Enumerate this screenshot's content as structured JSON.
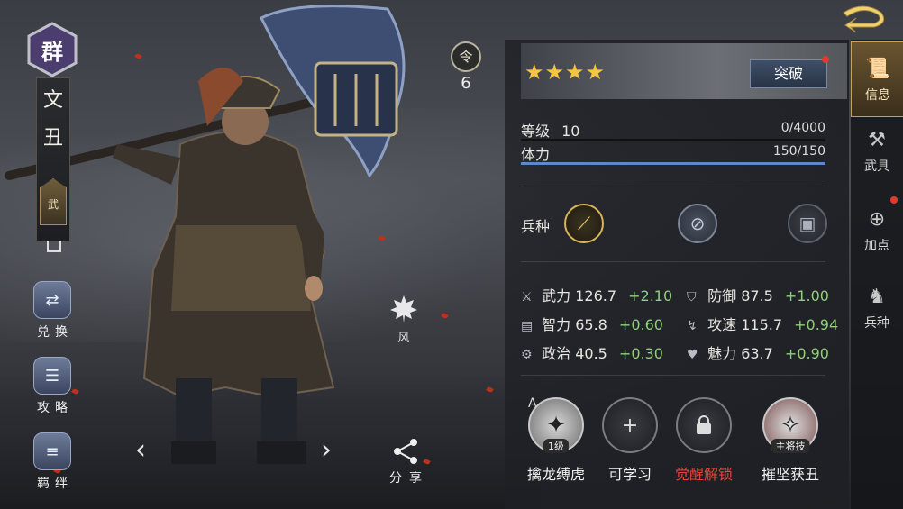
{
  "hero": {
    "faction": "群",
    "name_chars": [
      "文",
      "丑"
    ],
    "role": "武",
    "ling_label": "令",
    "ling_count": "6"
  },
  "side_buttons": [
    {
      "label": "兑换",
      "icon": "exchange-icon"
    },
    {
      "label": "攻略",
      "icon": "guide-scroll-icon"
    },
    {
      "label": "羁绊",
      "icon": "bond-scroll-icon"
    }
  ],
  "wind": {
    "label": "风",
    "icon": "maple-leaf-icon"
  },
  "share": {
    "label": "分享",
    "icon": "share-icon"
  },
  "panel": {
    "stars": "★★★★",
    "star_count": 4,
    "break_label": "突破",
    "level_label": "等级",
    "level_value": "10",
    "exp_value": "0/4000",
    "exp_fraction": 0,
    "stamina_label": "体力",
    "stamina_value": "150/150",
    "stamina_fraction": 1,
    "troop_label": "兵种",
    "troop_icons": [
      "spear-troop-icon",
      "shield-troop-icon",
      "armor-troop-icon"
    ],
    "attributes": [
      {
        "icon": "sword-icon",
        "name": "武力",
        "value": "126.7",
        "bonus": "+2.10"
      },
      {
        "icon": "shield-icon",
        "name": "防御",
        "value": "87.5",
        "bonus": "+1.00"
      },
      {
        "icon": "book-icon",
        "name": "智力",
        "value": "65.8",
        "bonus": "+0.60"
      },
      {
        "icon": "boot-icon",
        "name": "攻速",
        "value": "115.7",
        "bonus": "+0.94"
      },
      {
        "icon": "gear-icon",
        "name": "政治",
        "value": "40.5",
        "bonus": "+0.30"
      },
      {
        "icon": "heart-icon",
        "name": "魅力",
        "value": "63.7",
        "bonus": "+0.90"
      }
    ],
    "skill_marker": "A",
    "skills": [
      {
        "name": "擒龙缚虎",
        "tag": "1级",
        "icon": "warrior-skill-icon",
        "red": false
      },
      {
        "name": "可学习",
        "tag": "",
        "icon": "plus-icon",
        "red": false
      },
      {
        "name": "觉醒解锁",
        "tag": "",
        "icon": "lock-icon",
        "red": true
      },
      {
        "name": "摧坚获丑",
        "tag": "主将技",
        "icon": "general-skill-icon",
        "red": false
      }
    ]
  },
  "tabs": [
    {
      "label": "信息",
      "icon": "scroll-icon",
      "active": true
    },
    {
      "label": "武具",
      "icon": "weapon-rack-icon",
      "active": false
    },
    {
      "label": "加点",
      "icon": "add-point-icon",
      "active": false
    },
    {
      "label": "兵种",
      "icon": "soldier-icon",
      "active": false
    }
  ],
  "colors": {
    "gold_star": "#f5c542",
    "bonus_green": "#8fd07a",
    "red_text": "#e3463a",
    "accent_blue": "#5f87c9"
  }
}
